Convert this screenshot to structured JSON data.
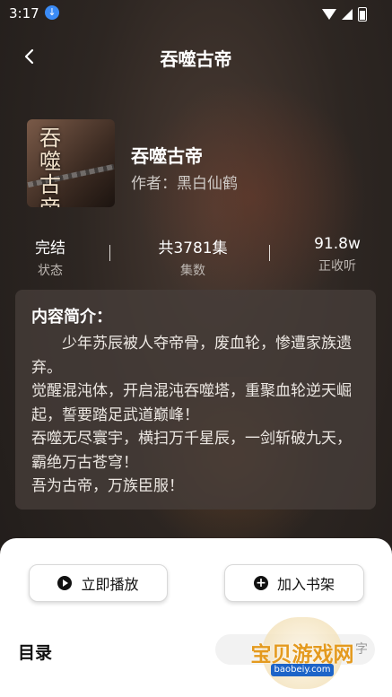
{
  "status_bar": {
    "time": "3:17",
    "download_icon": "download-icon",
    "wifi_icon": "wifi-icon",
    "signal_icon": "signal-icon",
    "battery_icon": "battery-charging-icon"
  },
  "header": {
    "back_icon": "chevron-left-icon",
    "title": "吞噬古帝"
  },
  "book": {
    "cover_text": "吞噬古帝",
    "name": "吞噬古帝",
    "author": "作者：黑白仙鹤"
  },
  "stats": [
    {
      "value": "完结",
      "label": "状态"
    },
    {
      "value": "共3781集",
      "label": "集数"
    },
    {
      "value": "91.8w",
      "label": "正收听"
    }
  ],
  "intro": {
    "heading": "内容简介：",
    "text": "　　少年苏辰被人夺帝骨，废血轮，惨遭家族遗弃。\n觉醒混沌体，开启混沌吞噬塔，重聚血轮逆天崛起，誓要踏足武道巅峰！\n吞噬无尽寰宇，横扫万千星辰，一剑斩破九天，霸绝万古苍穹！\n吾为古帝，万族臣服！"
  },
  "actions": {
    "play_label": "立即播放",
    "play_icon": "play-circle-icon",
    "shelf_label": "加入书架",
    "shelf_icon": "add-circle-icon"
  },
  "catalog": {
    "label": "目录",
    "sort_label": "字"
  },
  "watermark": {
    "text": "宝贝游戏网",
    "url": "baobeiy.com"
  },
  "colors": {
    "sheet_bg": "#ffffff",
    "accent_badge": "#3b8bf5",
    "watermark": "#e49a1e"
  }
}
